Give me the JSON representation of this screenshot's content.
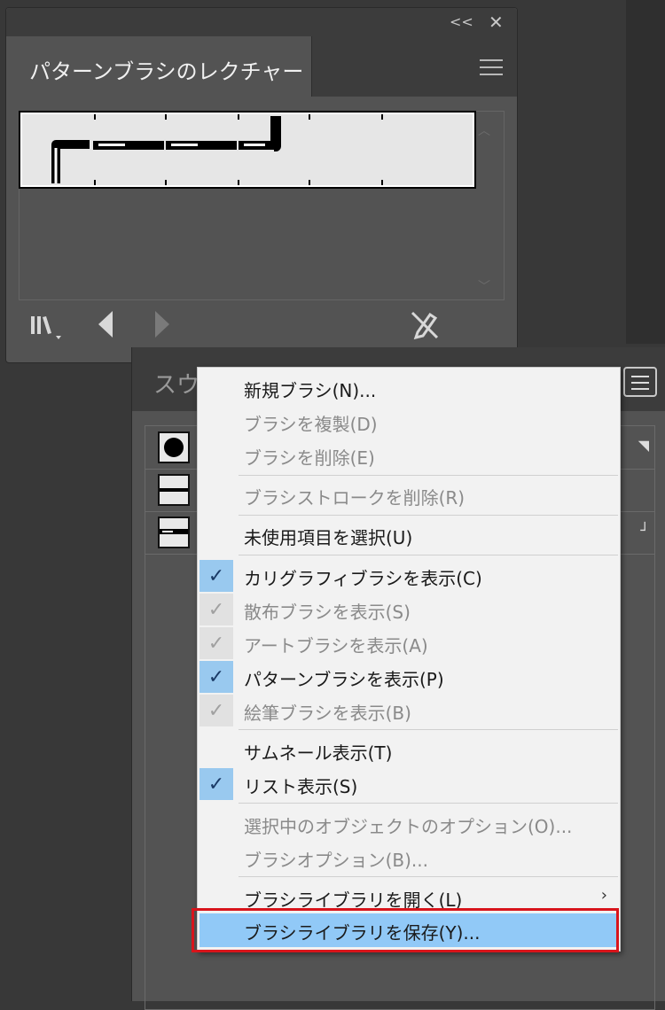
{
  "top_panel": {
    "collapse_glyph": "<<",
    "close_glyph": "✕",
    "tab_title": "パターンブラシのレクチャー",
    "icons": [
      "hamburger-menu-icon",
      "brush-library-icon",
      "previous-triangle-icon",
      "next-triangle-icon",
      "remove-brush-stroke-icon"
    ]
  },
  "brushes_panel": {
    "tab_label": "スウ",
    "rows": [
      {
        "thumb": "dot-brush"
      },
      {
        "thumb": "line-brush"
      },
      {
        "thumb": "pattern-brush"
      }
    ]
  },
  "context_menu": {
    "items": [
      {
        "label": "新規ブラシ(N)...",
        "enabled": true,
        "check": "none"
      },
      {
        "label": "ブラシを複製(D)",
        "enabled": false,
        "check": "none"
      },
      {
        "label": "ブラシを削除(E)",
        "enabled": false,
        "check": "none"
      },
      {
        "label": "ブラシストロークを削除(R)",
        "enabled": false,
        "check": "none"
      },
      {
        "label": "未使用項目を選択(U)",
        "enabled": true,
        "check": "none"
      },
      {
        "label": "カリグラフィブラシを表示(C)",
        "enabled": true,
        "check": "on"
      },
      {
        "label": "散布ブラシを表示(S)",
        "enabled": false,
        "check": "dim"
      },
      {
        "label": "アートブラシを表示(A)",
        "enabled": false,
        "check": "dim"
      },
      {
        "label": "パターンブラシを表示(P)",
        "enabled": true,
        "check": "on"
      },
      {
        "label": "絵筆ブラシを表示(B)",
        "enabled": false,
        "check": "dim"
      },
      {
        "label": "サムネール表示(T)",
        "enabled": true,
        "check": "none"
      },
      {
        "label": "リスト表示(S)",
        "enabled": true,
        "check": "on"
      },
      {
        "label": "選択中のオブジェクトのオプション(O)...",
        "enabled": false,
        "check": "none"
      },
      {
        "label": "ブラシオプション(B)...",
        "enabled": false,
        "check": "none"
      },
      {
        "label": "ブラシライブラリを開く(L)",
        "enabled": true,
        "check": "none",
        "submenu": true
      },
      {
        "label": "ブラシライブラリを保存(Y)...",
        "enabled": true,
        "check": "none",
        "highlighted": true
      }
    ]
  },
  "colors": {
    "highlight": "#91c9f7",
    "checkbox": "#99c9ef",
    "callout": "#d8141b"
  }
}
